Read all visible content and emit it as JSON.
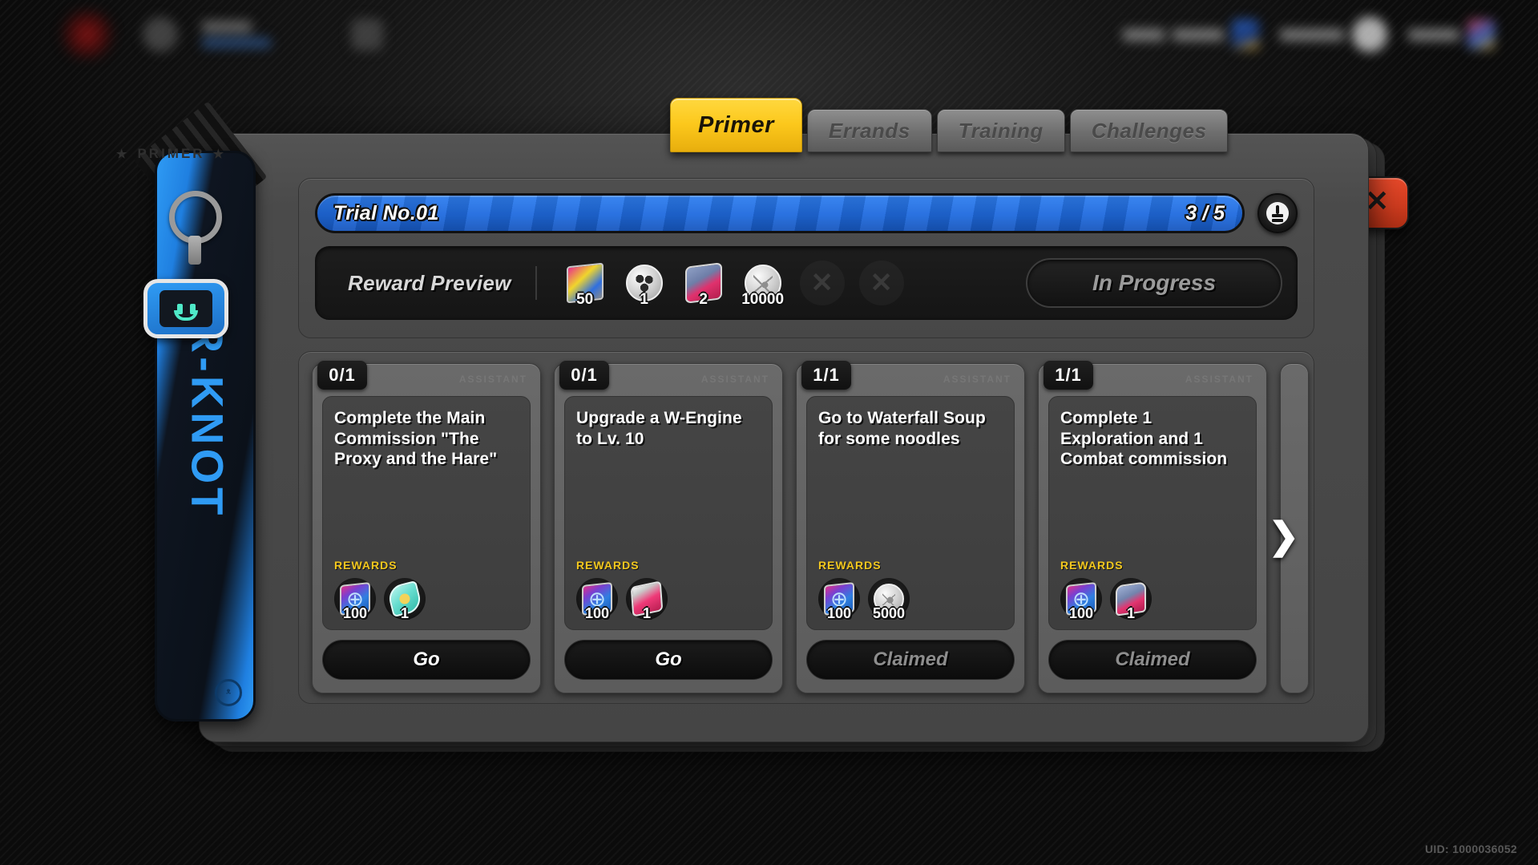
{
  "window": {
    "title": "PRIMER",
    "uid": "UID: 1000036052",
    "close_label": "✕"
  },
  "tabs": [
    {
      "label": "Primer",
      "active": true
    },
    {
      "label": "Errands",
      "active": false
    },
    {
      "label": "Training",
      "active": false
    },
    {
      "label": "Challenges",
      "active": false
    }
  ],
  "trial": {
    "name": "Trial No.01",
    "progress_text": "3 / 5",
    "progress_current": 3,
    "progress_total": 5,
    "progress_percent": 100,
    "info_icon": "info-icon",
    "accent_color": "#2f7ff0"
  },
  "reward_preview": {
    "label": "Reward Preview",
    "status_label": "In Progress",
    "items": [
      {
        "icon": "film-cards-icon",
        "art": "art-cards",
        "amount": "50"
      },
      {
        "icon": "film-reel-icon",
        "art": "art-reel",
        "amount": "1"
      },
      {
        "icon": "pink-module-icon",
        "art": "art-pink",
        "amount": "2"
      },
      {
        "icon": "denny-icon",
        "art": "art-denny",
        "amount": "10000"
      },
      {
        "icon": "empty-slot-icon",
        "art": "empty",
        "amount": ""
      },
      {
        "icon": "empty-slot-icon",
        "art": "empty",
        "amount": ""
      }
    ]
  },
  "cards": {
    "deco_text": "ASSISTANT",
    "rewards_label": "REWARDS",
    "next_arrow": "❯",
    "items": [
      {
        "count": "0/1",
        "task": "Complete the Main Commission \"The Proxy and the Hare\"",
        "button": "Go",
        "claimed": false,
        "rewards": [
          {
            "icon": "inter-knot-notebook-icon",
            "art": "art-notebook",
            "amount": "100"
          },
          {
            "icon": "teal-investigation-icon",
            "art": "art-teal",
            "amount": "1"
          }
        ]
      },
      {
        "count": "0/1",
        "task": "Upgrade a W-Engine to Lv. 10",
        "button": "Go",
        "claimed": false,
        "rewards": [
          {
            "icon": "inter-knot-notebook-icon",
            "art": "art-notebook",
            "amount": "100"
          },
          {
            "icon": "pink-box-icon",
            "art": "art-pinkbox",
            "amount": "1"
          }
        ]
      },
      {
        "count": "1/1",
        "task": "Go to Waterfall Soup for some noodles",
        "button": "Claimed",
        "claimed": true,
        "rewards": [
          {
            "icon": "inter-knot-notebook-icon",
            "art": "art-notebook",
            "amount": "100"
          },
          {
            "icon": "denny-icon",
            "art": "art-denny",
            "amount": "5000"
          }
        ]
      },
      {
        "count": "1/1",
        "task": "Complete 1 Exploration and 1 Combat commission",
        "button": "Claimed",
        "claimed": true,
        "rewards": [
          {
            "icon": "inter-knot-notebook-icon",
            "art": "art-notebook",
            "amount": "100"
          },
          {
            "icon": "pink-car-icon",
            "art": "art-pinkcar",
            "amount": "1"
          }
        ]
      }
    ]
  },
  "keychain": {
    "text": "R-KNOT",
    "sub": "DS",
    "smile": "ᵜ",
    "boo_icon": "bangboo-face-icon"
  },
  "bottom_nav": [
    {
      "icon": "grid-icon",
      "shape": "g1"
    },
    {
      "icon": "agents-icon",
      "shape": "round"
    },
    {
      "icon": "w-engine-icon",
      "shape": "rrect"
    },
    {
      "icon": "drive-disc-icon",
      "shape": "rrect"
    },
    {
      "icon": "bangboo-icon",
      "shape": "round"
    },
    {
      "icon": "shop-icon",
      "shape": "rrect"
    },
    {
      "icon": "inter-knot-icon",
      "shape": "round"
    },
    {
      "icon": "battle-icon",
      "shape": "rrect"
    },
    {
      "icon": "mail-icon",
      "shape": "rrect"
    },
    {
      "icon": "banner-icon",
      "shape": "colorful"
    }
  ]
}
